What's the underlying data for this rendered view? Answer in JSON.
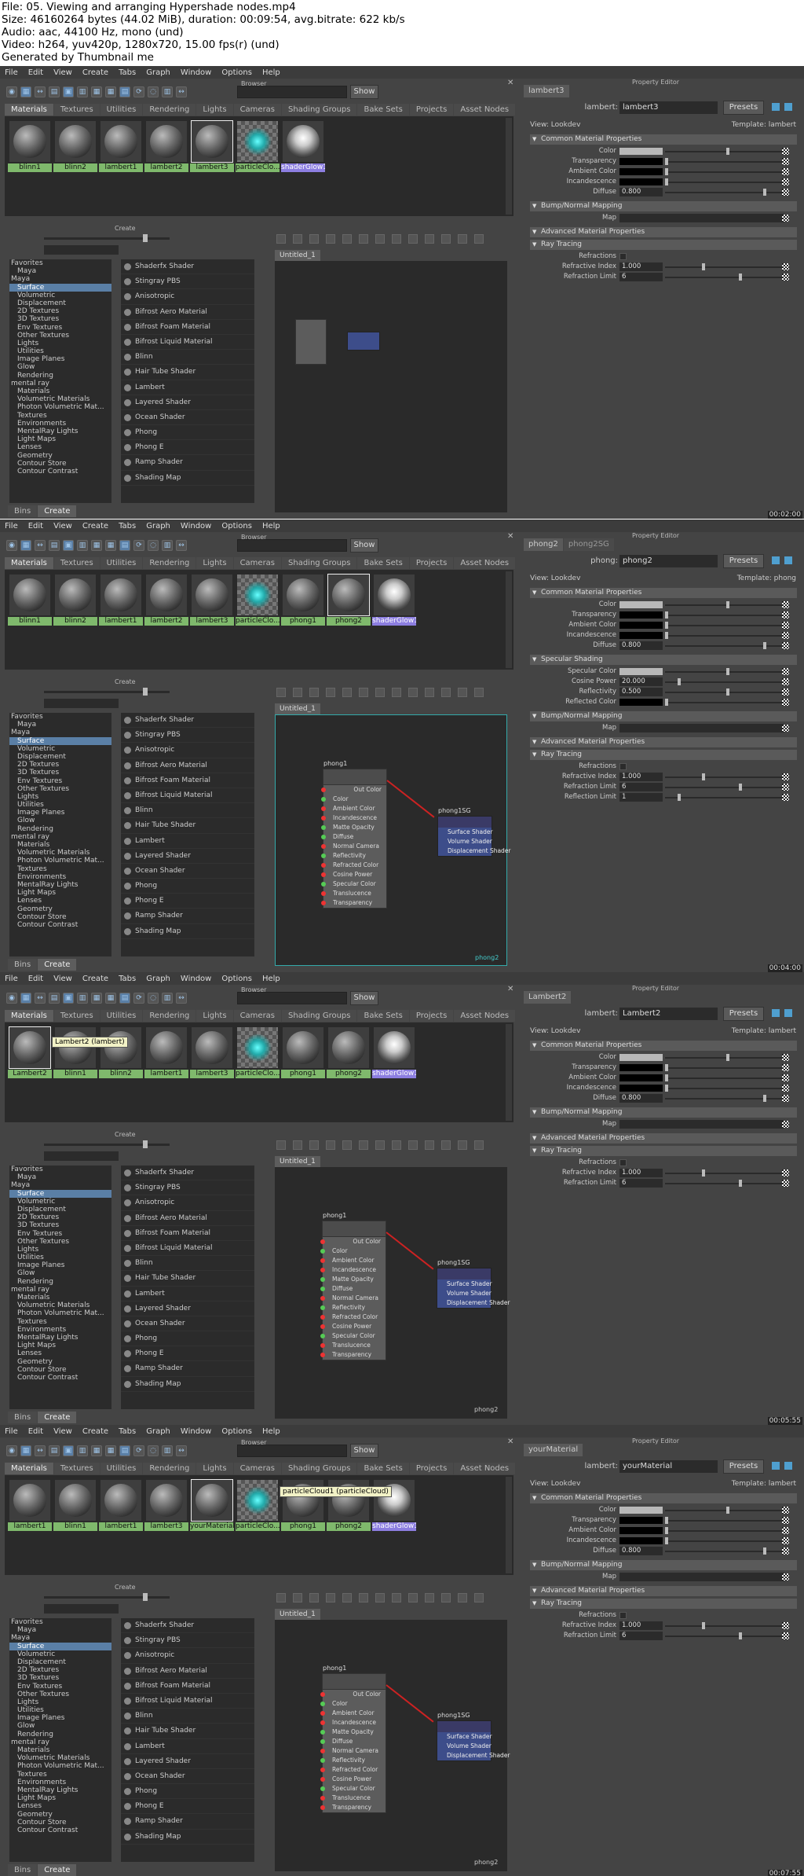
{
  "info": {
    "line1": "File: 05. Viewing and arranging Hypershade nodes.mp4",
    "line2": "Size: 46160264 bytes (44.02 MiB), duration: 00:09:54, avg.bitrate: 622 kb/s",
    "line3": "Audio: aac, 44100 Hz, mono (und)",
    "line4": "Video: h264, yuv420p, 1280x720, 15.00 fps(r) (und)",
    "line5": "Generated by Thumbnail me"
  },
  "menu": [
    "File",
    "Edit",
    "View",
    "Create",
    "Tabs",
    "Graph",
    "Window",
    "Options",
    "Help"
  ],
  "browser_title": "Browser",
  "show_label": "Show",
  "tabs": [
    "Materials",
    "Textures",
    "Utilities",
    "Rendering",
    "Lights",
    "Cameras",
    "Shading Groups",
    "Bake Sets",
    "Projects",
    "Asset Nodes"
  ],
  "create_title": "Create",
  "categories": [
    "Favorites",
    "Maya",
    "Maya",
    "Surface",
    "Volumetric",
    "Displacement",
    "2D Textures",
    "3D Textures",
    "Env Textures",
    "Other Textures",
    "Lights",
    "Utilities",
    "Image Planes",
    "Glow",
    "Rendering",
    "mental ray",
    "Materials",
    "Volumetric Materials",
    "Photon Volumetric Mat...",
    "Textures",
    "Environments",
    "MentalRay Lights",
    "Light Maps",
    "Lenses",
    "Geometry",
    "Contour Store",
    "Contour Contrast"
  ],
  "nodes": [
    "Shaderfx Shader",
    "Stingray PBS",
    "Anisotropic",
    "Bifrost Aero Material",
    "Bifrost Foam Material",
    "Bifrost Liquid Material",
    "Blinn",
    "Hair Tube Shader",
    "Lambert",
    "Layered Shader",
    "Ocean Shader",
    "Phong",
    "Phong E",
    "Ramp Shader",
    "Shading Map"
  ],
  "bins": [
    "Bins",
    "Create"
  ],
  "work_tab": "Untitled_1",
  "pe_title": "Property Editor",
  "pe_view": "View: Lookdev",
  "presets": "Presets",
  "phong_attrs": [
    "Color",
    "Ambient Color",
    "Incandescence",
    "Matte Opacity",
    "Diffuse",
    "Normal Camera",
    "Reflectivity",
    "Refracted Color",
    "Cosine Power",
    "Specular Color",
    "Translucence",
    "Transparency"
  ],
  "sg_attrs": [
    "Surface Shader",
    "Volume Shader",
    "Displacement Shader"
  ],
  "out_color": "Out Color",
  "sections": {
    "common": "Common Material Properties",
    "bump": "Bump/Normal Mapping",
    "advanced": "Advanced Material Properties",
    "ray": "Ray Tracing",
    "specular": "Specular Shading"
  },
  "common_attrs": [
    "Color",
    "Transparency",
    "Ambient Color",
    "Incandescence",
    "Diffuse"
  ],
  "specular_attrs": [
    "Specular Color",
    "Cosine Power",
    "Reflectivity",
    "Reflected Color"
  ],
  "map_label": "Map",
  "values": {
    "diffuse": "0.800",
    "refr_index": "1.000",
    "refr_limit": "6",
    "refl_limit": "1",
    "cosine": "20.000",
    "reflectivity": "0.500"
  },
  "ray_attrs": [
    "Refractions",
    "Refractive Index",
    "Refraction Limit",
    "Reflection Limit"
  ],
  "frames": [
    {
      "timestamp": "00:02:00",
      "swatches": [
        "blinn1",
        "blinn2",
        "lambert1",
        "lambert2",
        "lambert3",
        "particleClo...",
        "shaderGlow1"
      ],
      "pe_tabs": [
        "lambert3"
      ],
      "pe_type": "lambert:",
      "pe_name": "lambert3",
      "template": "Template: lambert",
      "hover_item": "Lambert"
    },
    {
      "timestamp": "00:04:00",
      "swatches": [
        "blinn1",
        "blinn2",
        "lambert1",
        "lambert2",
        "lambert3",
        "particleClo...",
        "phong1",
        "phong2",
        "shaderGlow1"
      ],
      "pe_tabs": [
        "phong2",
        "phong2SG"
      ],
      "pe_type": "phong:",
      "pe_name": "phong2",
      "template": "Template: phong",
      "graph_node": "phong1",
      "graph_sg": "phong1SG",
      "graph_label": "phong2"
    },
    {
      "timestamp": "00:05:55",
      "swatches": [
        "Lambert2",
        "blinn1",
        "blinn2",
        "lambert1",
        "lambert3",
        "particleClo...",
        "phong1",
        "phong2",
        "shaderGlow1"
      ],
      "pe_tabs": [
        "Lambert2"
      ],
      "pe_type": "lambert:",
      "pe_name": "Lambert2",
      "template": "Template: lambert",
      "tooltip": "Lambert2 (lambert)",
      "graph_node": "phong1",
      "graph_sg": "phong1SG",
      "graph_label": "phong2"
    },
    {
      "timestamp": "00:07:55",
      "swatches": [
        "lambert1",
        "blinn1",
        "lambert1",
        "lambert3",
        "yourMaterial",
        "particleClo...",
        "phong1",
        "phong2",
        "shaderGlow1"
      ],
      "pe_tabs": [
        "yourMaterial"
      ],
      "pe_type": "lambert:",
      "pe_name": "yourMaterial",
      "template": "Template: lambert",
      "tooltip": "particleCloud1 (particleCloud)",
      "graph_node": "phong1",
      "graph_sg": "phong1SG",
      "graph_label": "phong2"
    }
  ]
}
